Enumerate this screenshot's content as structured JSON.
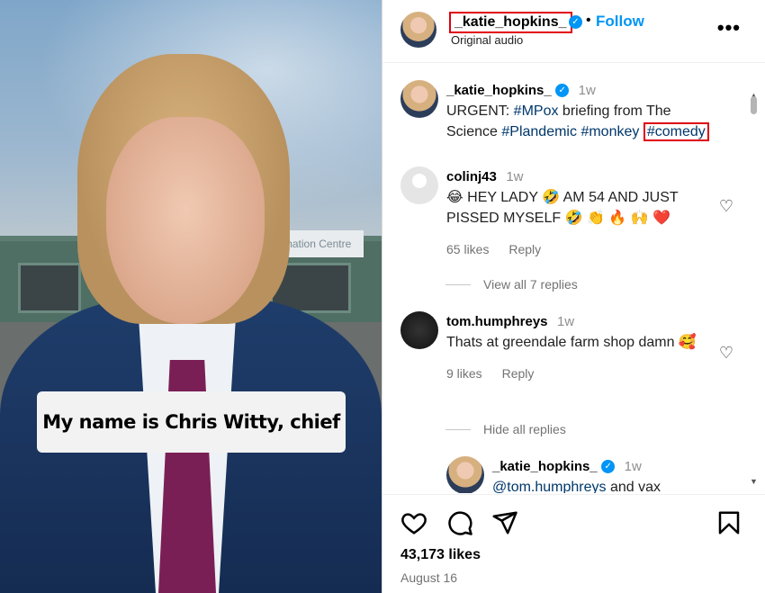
{
  "video": {
    "caption": "My name is Chris Witty, chief",
    "sign_text": "Vaccination Centre"
  },
  "header": {
    "username": "_katie_hopkins_",
    "verified_icon": "verified-badge-icon",
    "separator": "•",
    "follow_label": "Follow",
    "audio_label": "Original audio",
    "more_icon": "more-options-icon"
  },
  "post_caption": {
    "username": "_katie_hopkins_",
    "time": "1w",
    "text_before": "URGENT: ",
    "tag1": "#MPox",
    "text_mid": " briefing from The Science ",
    "tag2": "#Plandemic",
    "tag3": "#monkey",
    "tag4": "#comedy"
  },
  "comments": [
    {
      "username": "colinj43",
      "time": "1w",
      "text": "😂 HEY LADY 🤣 AM 54 AND JUST PISSED MYSELF 🤣 👏 🔥 🙌 ❤️",
      "likes": "65 likes",
      "reply_label": "Reply",
      "replies_toggle": "View all 7 replies"
    },
    {
      "username": "tom.humphreys",
      "time": "1w",
      "text": "Thats at greendale farm shop damn 🥰",
      "likes": "9 likes",
      "reply_label": "Reply",
      "replies_toggle": "Hide all replies"
    }
  ],
  "reply": {
    "username": "_katie_hopkins_",
    "time": "1w",
    "mention": "@tom.humphreys",
    "text": " and vax"
  },
  "actions": {
    "like_icon": "heart-icon",
    "comment_icon": "comment-icon",
    "share_icon": "share-icon",
    "save_icon": "bookmark-icon",
    "likes": "43,173 likes",
    "date": "August 16"
  }
}
